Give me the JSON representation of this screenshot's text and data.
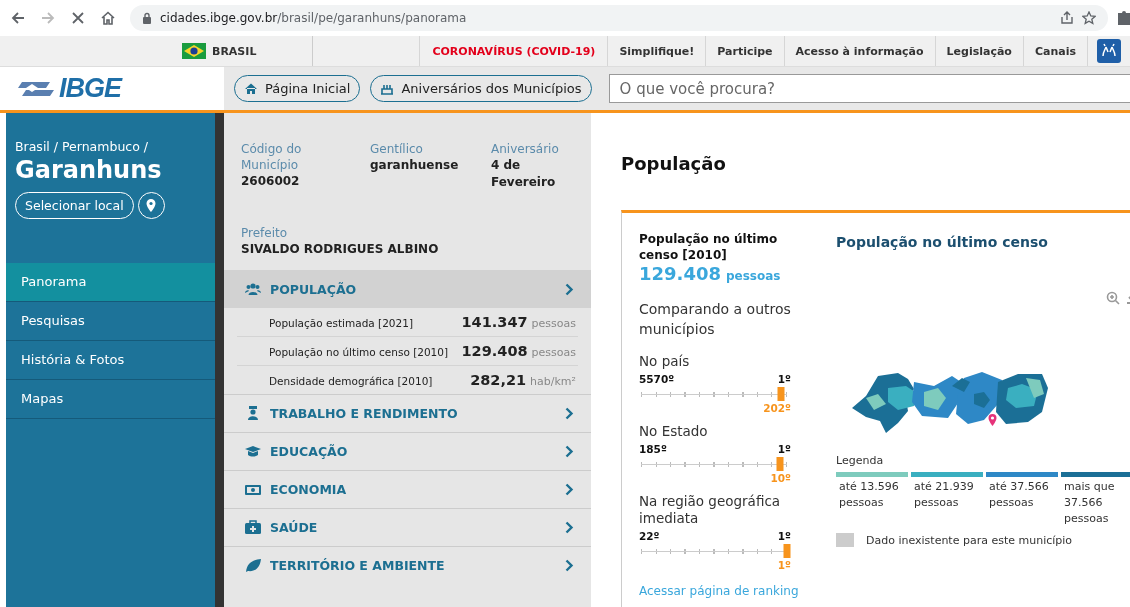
{
  "browser": {
    "url_host": "cidades.ibge.gov.br",
    "url_path": "/brasil/pe/garanhuns/panorama"
  },
  "gov_bar": {
    "country": "BRASIL",
    "links": [
      {
        "label": "CORONAVÍRUS (COVID-19)",
        "kind": "alert"
      },
      {
        "label": "Simplifique!",
        "kind": "link"
      },
      {
        "label": "Participe",
        "kind": "link"
      },
      {
        "label": "Acesso à informação",
        "kind": "link"
      },
      {
        "label": "Legislação",
        "kind": "link"
      },
      {
        "label": "Canais",
        "kind": "link"
      }
    ]
  },
  "header": {
    "logo": "IBGE",
    "buttons": [
      "Página Inicial",
      "Aniversários dos Municípios"
    ],
    "search": {
      "placeholder": "O que você procura?"
    }
  },
  "sidebar": {
    "breadcrumb": "Brasil / Pernambuco /",
    "city": "Garanhuns",
    "select_button": "Selecionar local",
    "nav": [
      {
        "label": "Panorama",
        "selected": true
      },
      {
        "label": "Pesquisas",
        "selected": false
      },
      {
        "label": "História & Fotos",
        "selected": false
      },
      {
        "label": "Mapas",
        "selected": false
      }
    ]
  },
  "summary": {
    "facts": [
      {
        "label": "Código do Município",
        "value": "2606002"
      },
      {
        "label": "Gentílico",
        "value": "garanhuense"
      },
      {
        "label": "Aniversário",
        "value": "4 de Fevereiro"
      }
    ],
    "mayor": {
      "label": "Prefeito",
      "value": "SIVALDO RODRIGUES ALBINO"
    },
    "sections": [
      {
        "title": "POPULAÇÃO",
        "expanded": true,
        "rows": [
          {
            "label": "População estimada [2021]",
            "value": "141.347",
            "unit": "pessoas"
          },
          {
            "label": "População no último censo [2010]",
            "value": "129.408",
            "unit": "pessoas"
          },
          {
            "label": "Densidade demográfica [2010]",
            "value": "282,21",
            "unit": "hab/km²"
          }
        ]
      },
      {
        "title": "TRABALHO E RENDIMENTO",
        "expanded": false
      },
      {
        "title": "EDUCAÇÃO",
        "expanded": false
      },
      {
        "title": "ECONOMIA",
        "expanded": false
      },
      {
        "title": "SAÚDE",
        "expanded": false
      },
      {
        "title": "TERRITÓRIO E AMBIENTE",
        "expanded": false
      }
    ]
  },
  "population": {
    "title": "População",
    "card": {
      "heading": "População no último censo [2010]",
      "value": "129.408",
      "unit": "pessoas",
      "compare_title": "Comparando a outros municípios",
      "rankings": [
        {
          "label": "No país",
          "min": "5570º",
          "max": "1º",
          "position": "202º",
          "level": 0.96
        },
        {
          "label": "No Estado",
          "min": "185º",
          "max": "1º",
          "position": "10º",
          "level": 0.95
        },
        {
          "label": "Na região geográfica imediata",
          "min": "22º",
          "max": "1º",
          "position": "1º",
          "level": 1
        }
      ],
      "ranking_link": "Acessar página de ranking"
    },
    "map": {
      "title": "População no último censo",
      "legend_title": "Legenda",
      "legend": [
        {
          "label": "até 13.596 pessoas",
          "color": "#7ecbbd"
        },
        {
          "label": "até 21.939 pessoas",
          "color": "#3aafc0"
        },
        {
          "label": "até 37.566 pessoas",
          "color": "#2e88c6"
        },
        {
          "label": "mais que 37.566 pessoas",
          "color": "#1b6f96"
        }
      ],
      "missing": "Dado inexistente para este município"
    }
  }
}
